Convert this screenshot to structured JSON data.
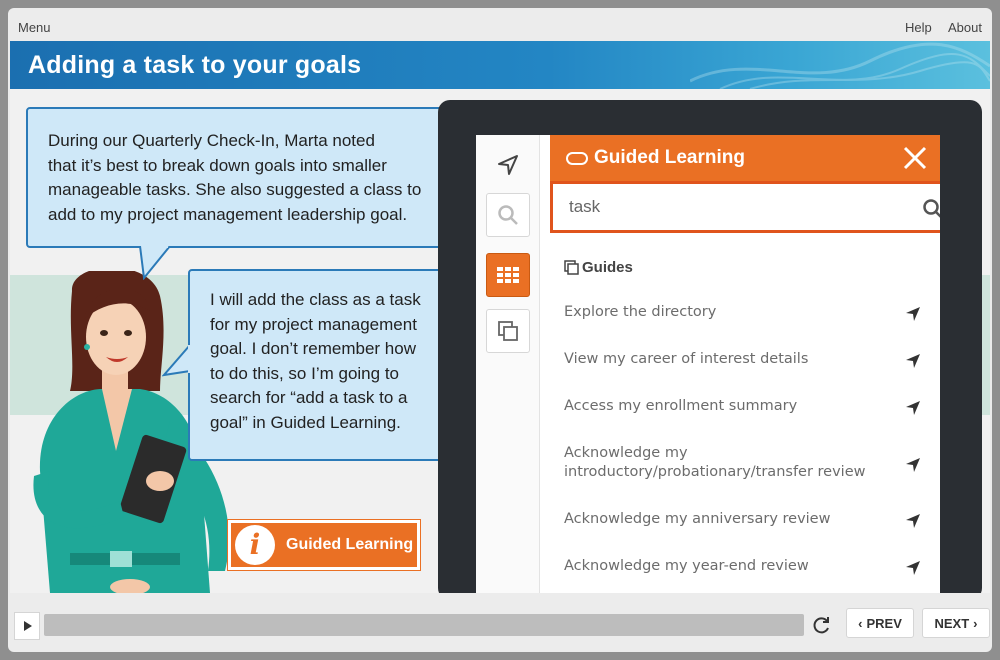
{
  "player": {
    "menu_label": "Menu",
    "help_label": "Help",
    "about_label": "About"
  },
  "slide": {
    "title": "Adding a task to your goals",
    "bubble1": [
      "During our Quarterly Check-In, Marta noted",
      "that it’s best to break down goals into smaller",
      "manageable tasks. She also suggested a class to",
      "add to my project management leadership goal."
    ],
    "bubble2": [
      "I will add the class as a task",
      "for my project management",
      "goal. I don’t remember how",
      "to do this, so I’m going to",
      "search for “add a task to a",
      "goal” in Guided Learning."
    ],
    "gl_button_label": "Guided Learning",
    "gl_button_icon": "info-icon"
  },
  "guided_panel": {
    "title": "Guided Learning",
    "search_value": "task",
    "section_label": "Guides",
    "items": [
      {
        "label": "Explore the directory"
      },
      {
        "label": "View my career of interest details"
      },
      {
        "label": "Access my enrollment summary"
      },
      {
        "label": "Acknowledge my introductory/probationary/transfer review"
      },
      {
        "label": "Acknowledge my anniversary review"
      },
      {
        "label": "Acknowledge my year-end review"
      }
    ]
  },
  "controls": {
    "prev_label": "PREV",
    "next_label": "NEXT"
  },
  "colors": {
    "accent_orange": "#ea7024",
    "title_blue": "#1b6fb0",
    "bubble_fill": "#cfe8f8",
    "bubble_border": "#2b7ab8"
  }
}
